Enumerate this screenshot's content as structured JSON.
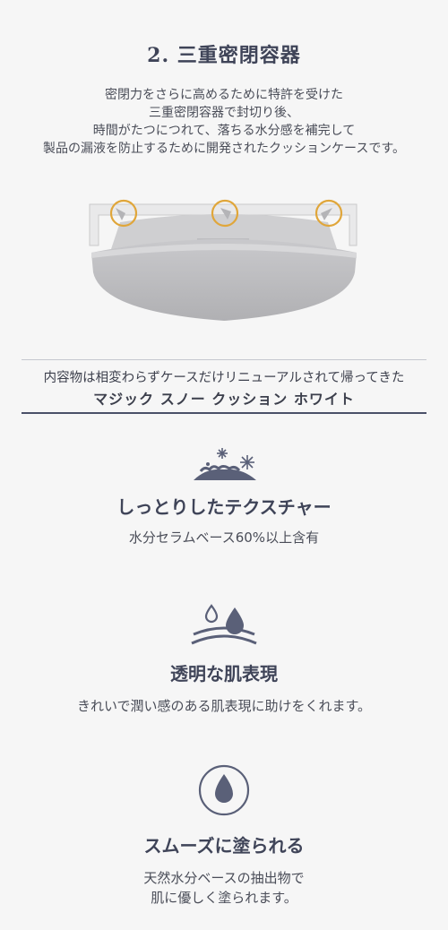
{
  "section": {
    "title": "2. 三重密閉容器",
    "description": [
      "密閉力をさらに高めるために特許を受けた",
      "三重密閉容器で封切り後、",
      "時間がたつにつれて、落ちる水分感を補完して",
      "製品の漏液を防止するために開発されたクッションケースです。"
    ]
  },
  "banner": {
    "subtitle": "内容物は相変わらずケースだけリニューアルされて帰ってきた",
    "product": "マジック スノー クッション ホワイト"
  },
  "features": [
    {
      "icon": "snow-cloud-icon",
      "title": "しっとりしたテクスチャー",
      "lines": [
        "水分セラムベース60%以上含有"
      ]
    },
    {
      "icon": "water-drop-skin-icon",
      "title": "透明な肌表現",
      "lines": [
        "きれいで潤い感のある肌表現に助けをくれます。"
      ]
    },
    {
      "icon": "drop-circle-icon",
      "title": "スムーズに塗られる",
      "lines": [
        "天然水分ベースの抽出物で",
        "肌に優しく塗られます。"
      ]
    }
  ],
  "colors": {
    "accent_gold": "#e0a63a",
    "navy": "#4a5068",
    "container_gray": "#b8b8bb"
  }
}
